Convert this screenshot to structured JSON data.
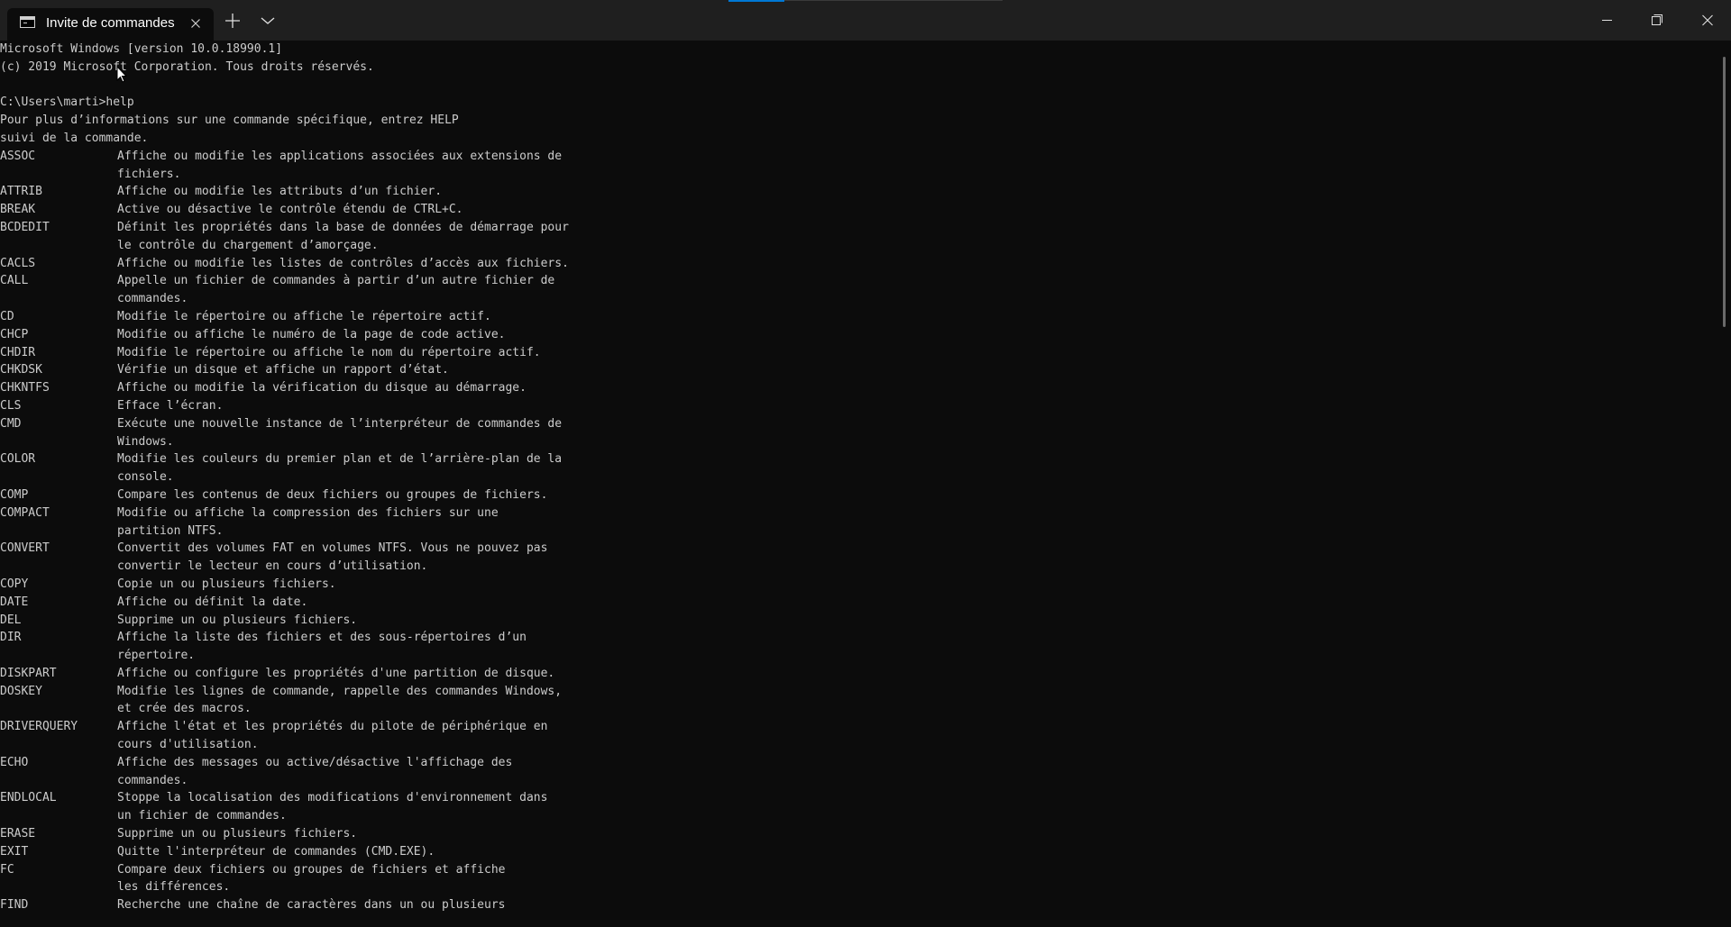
{
  "window": {
    "tab_title": "Invite de commandes",
    "tab_icon": "cmd-icon",
    "new_tab_icon": "plus-icon",
    "dropdown_icon": "chevron-down-icon",
    "minimize_icon": "minimize-icon",
    "restore_icon": "restore-icon",
    "close_icon": "close-icon"
  },
  "console": {
    "header_lines": [
      "Microsoft Windows [version 10.0.18990.1]",
      "(c) 2019 Microsoft Corporation. Tous droits réservés.",
      "",
      "C:\\Users\\marti>help",
      "Pour plus d’informations sur une commande spécifique, entrez HELP",
      "suivi de la commande."
    ],
    "entries": [
      {
        "cmd": "ASSOC",
        "lines": [
          "Affiche ou modifie les applications associées aux extensions de",
          "fichiers."
        ]
      },
      {
        "cmd": "ATTRIB",
        "lines": [
          "Affiche ou modifie les attributs d’un fichier."
        ]
      },
      {
        "cmd": "BREAK",
        "lines": [
          "Active ou désactive le contrôle étendu de CTRL+C."
        ]
      },
      {
        "cmd": "BCDEDIT",
        "lines": [
          "Définit les propriétés dans la base de données de démarrage pour",
          "le contrôle du chargement d’amorçage."
        ]
      },
      {
        "cmd": "CACLS",
        "lines": [
          "Affiche ou modifie les listes de contrôles d’accès aux fichiers."
        ]
      },
      {
        "cmd": "CALL",
        "lines": [
          "Appelle un fichier de commandes à partir d’un autre fichier de",
          "commandes."
        ]
      },
      {
        "cmd": "CD",
        "lines": [
          "Modifie le répertoire ou affiche le répertoire actif."
        ]
      },
      {
        "cmd": "CHCP",
        "lines": [
          "Modifie ou affiche le numéro de la page de code active."
        ]
      },
      {
        "cmd": "CHDIR",
        "lines": [
          "Modifie le répertoire ou affiche le nom du répertoire actif."
        ]
      },
      {
        "cmd": "CHKDSK",
        "lines": [
          "Vérifie un disque et affiche un rapport d’état."
        ]
      },
      {
        "cmd": "CHKNTFS",
        "lines": [
          "Affiche ou modifie la vérification du disque au démarrage."
        ]
      },
      {
        "cmd": "CLS",
        "lines": [
          "Efface l’écran."
        ]
      },
      {
        "cmd": "CMD",
        "lines": [
          "Exécute une nouvelle instance de l’interpréteur de commandes de",
          "Windows."
        ]
      },
      {
        "cmd": "COLOR",
        "lines": [
          "Modifie les couleurs du premier plan et de l’arrière-plan de la",
          "console."
        ]
      },
      {
        "cmd": "COMP",
        "lines": [
          "Compare les contenus de deux fichiers ou groupes de fichiers."
        ]
      },
      {
        "cmd": "COMPACT",
        "lines": [
          "Modifie ou affiche la compression des fichiers sur une",
          "partition NTFS."
        ]
      },
      {
        "cmd": "CONVERT",
        "lines": [
          "Convertit des volumes FAT en volumes NTFS. Vous ne pouvez pas",
          "convertir le lecteur en cours d’utilisation."
        ]
      },
      {
        "cmd": "COPY",
        "lines": [
          "Copie un ou plusieurs fichiers."
        ]
      },
      {
        "cmd": "DATE",
        "lines": [
          "Affiche ou définit la date."
        ]
      },
      {
        "cmd": "DEL",
        "lines": [
          "Supprime un ou plusieurs fichiers."
        ]
      },
      {
        "cmd": "DIR",
        "lines": [
          "Affiche la liste des fichiers et des sous-répertoires d’un",
          "répertoire."
        ]
      },
      {
        "cmd": "DISKPART",
        "lines": [
          "Affiche ou configure les propriétés d'une partition de disque."
        ]
      },
      {
        "cmd": "DOSKEY",
        "lines": [
          "Modifie les lignes de commande, rappelle des commandes Windows,",
          "et crée des macros."
        ]
      },
      {
        "cmd": "DRIVERQUERY",
        "lines": [
          "Affiche l'état et les propriétés du pilote de périphérique en",
          "cours d'utilisation."
        ]
      },
      {
        "cmd": "ECHO",
        "lines": [
          "Affiche des messages ou active/désactive l'affichage des",
          "commandes."
        ]
      },
      {
        "cmd": "ENDLOCAL",
        "lines": [
          "Stoppe la localisation des modifications d'environnement dans",
          "un fichier de commandes."
        ]
      },
      {
        "cmd": "ERASE",
        "lines": [
          "Supprime un ou plusieurs fichiers."
        ]
      },
      {
        "cmd": "EXIT",
        "lines": [
          "Quitte l'interpréteur de commandes (CMD.EXE)."
        ]
      },
      {
        "cmd": "FC",
        "lines": [
          "Compare deux fichiers ou groupes de fichiers et affiche",
          "les différences."
        ]
      },
      {
        "cmd": "FIND",
        "lines": [
          "Recherche une chaîne de caractères dans un ou plusieurs"
        ]
      }
    ]
  },
  "colors": {
    "background": "#0c0c0c",
    "titlebar": "#1f1f1f",
    "text": "#cccccc",
    "accent": "#0078d4"
  }
}
